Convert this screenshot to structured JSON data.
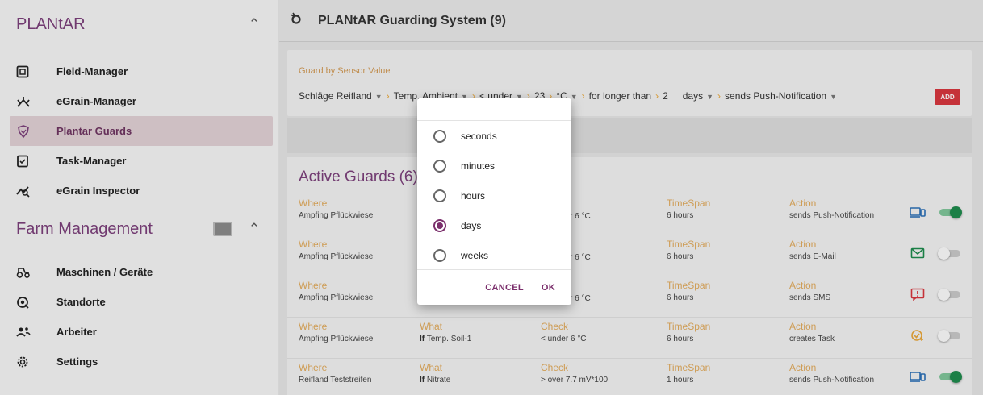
{
  "sidebar": {
    "app_title": "PLANtAR",
    "items": [
      {
        "label": "Field-Manager",
        "icon": "field-grid-icon"
      },
      {
        "label": "eGrain-Manager",
        "icon": "grain-icon"
      },
      {
        "label": "Plantar Guards",
        "icon": "guard-icon",
        "active": true
      },
      {
        "label": "Task-Manager",
        "icon": "task-icon"
      },
      {
        "label": "eGrain Inspector",
        "icon": "inspector-icon"
      }
    ],
    "section_title": "Farm Management",
    "farm_items": [
      {
        "label": "Maschinen / Geräte",
        "icon": "tractor-icon"
      },
      {
        "label": "Standorte",
        "icon": "location-icon"
      },
      {
        "label": "Arbeiter",
        "icon": "workers-icon"
      },
      {
        "label": "Settings",
        "icon": "gear-icon"
      }
    ]
  },
  "header": {
    "title": "PLANtAR Guarding System (9)"
  },
  "guard_form": {
    "label": "Guard by Sensor Value",
    "field": "Schläge Reifland",
    "sensor": "Temp. Ambient",
    "operator": "< under",
    "value": "23",
    "unit": "°C",
    "duration_label": "for longer than",
    "duration_value": "2",
    "duration_unit": "days",
    "action": "sends Push-Notification",
    "add_label": "ADD"
  },
  "active_guards": {
    "title": "Active Guards (6)",
    "headers": {
      "where": "Where",
      "what": "What",
      "check": "Check",
      "timespan": "TimeSpan",
      "action": "Action"
    },
    "rows": [
      {
        "where": "Ampfing Pflückwiese",
        "what_b": "",
        "what": "",
        "check": "r 6 °C",
        "timespan": "6 hours",
        "action": "sends Push-Notification",
        "icon": "device-icon",
        "enabled": true
      },
      {
        "where": "Ampfing Pflückwiese",
        "what_b": "",
        "what": "",
        "check": "r 6 °C",
        "timespan": "6 hours",
        "action": "sends E-Mail",
        "icon": "mail-icon",
        "enabled": false
      },
      {
        "where": "Ampfing Pflückwiese",
        "what_b": "",
        "what": "",
        "check": "r 6 °C",
        "timespan": "6 hours",
        "action": "sends SMS",
        "icon": "sms-alert-icon",
        "enabled": false
      },
      {
        "where": "Ampfing Pflückwiese",
        "what_b": "If",
        "what": "Temp. Soil-1",
        "check": "< under 6 °C",
        "timespan": "6 hours",
        "action": "creates Task",
        "icon": "task-check-icon",
        "enabled": false
      },
      {
        "where": "Reifland Teststreifen",
        "what_b": "If",
        "what": "Nitrate",
        "check": "> over 7.7 mV*100",
        "timespan": "1 hours",
        "action": "sends Push-Notification",
        "icon": "device-icon",
        "enabled": true
      }
    ]
  },
  "dialog": {
    "options": [
      "seconds",
      "minutes",
      "hours",
      "days",
      "weeks"
    ],
    "selected": "days",
    "cancel": "CANCEL",
    "ok": "OK"
  },
  "colors": {
    "brand": "#7b3f7a",
    "accent_orange": "#e0aa5c",
    "toggle_on": "#1e8a4c",
    "add_button": "#d6373e"
  }
}
